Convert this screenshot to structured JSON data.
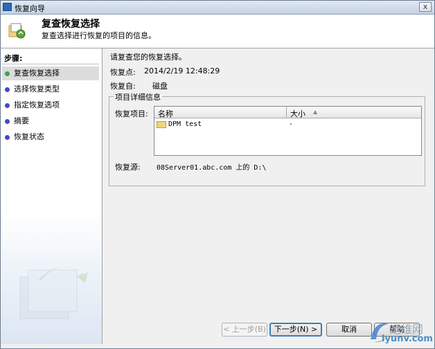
{
  "window": {
    "title": "恢复向导",
    "close_glyph": "x"
  },
  "header": {
    "title": "复查恢复选择",
    "subtitle": "复查选择进行恢复的项目的信息。"
  },
  "sidebar": {
    "title": "步骤:",
    "steps": [
      {
        "label": "复查恢复选择",
        "active": true
      },
      {
        "label": "选择恢复类型"
      },
      {
        "label": "指定恢复选项"
      },
      {
        "label": "摘要"
      },
      {
        "label": "恢复状态"
      }
    ]
  },
  "content": {
    "intro": "请复查您的恢复选择。",
    "recovery_point_label": "恢复点:",
    "recovery_point_value": "2014/2/19 12:48:29",
    "recover_from_label": "恢复自:",
    "recover_from_value": "磁盘",
    "group_title": "项目详细信息",
    "items_label": "恢复项目:",
    "columns": {
      "name": "名称",
      "size": "大小",
      "sort_glyph": "▲"
    },
    "rows": [
      {
        "name": "DPM test",
        "size": "-"
      }
    ],
    "source_label": "恢复源:",
    "source_value": "08Server01.abc.com 上的 D:\\"
  },
  "buttons": {
    "back": "< 上一步(B)",
    "next": "下一步(N) >",
    "cancel": "取消",
    "help": "帮助"
  },
  "watermark": {
    "line1": "运维网",
    "line2": "iyunv.com"
  },
  "colors": {
    "accent": "#3c7fb1",
    "step_dot": "#3b4fc4",
    "step_dot_active": "#41a041"
  }
}
